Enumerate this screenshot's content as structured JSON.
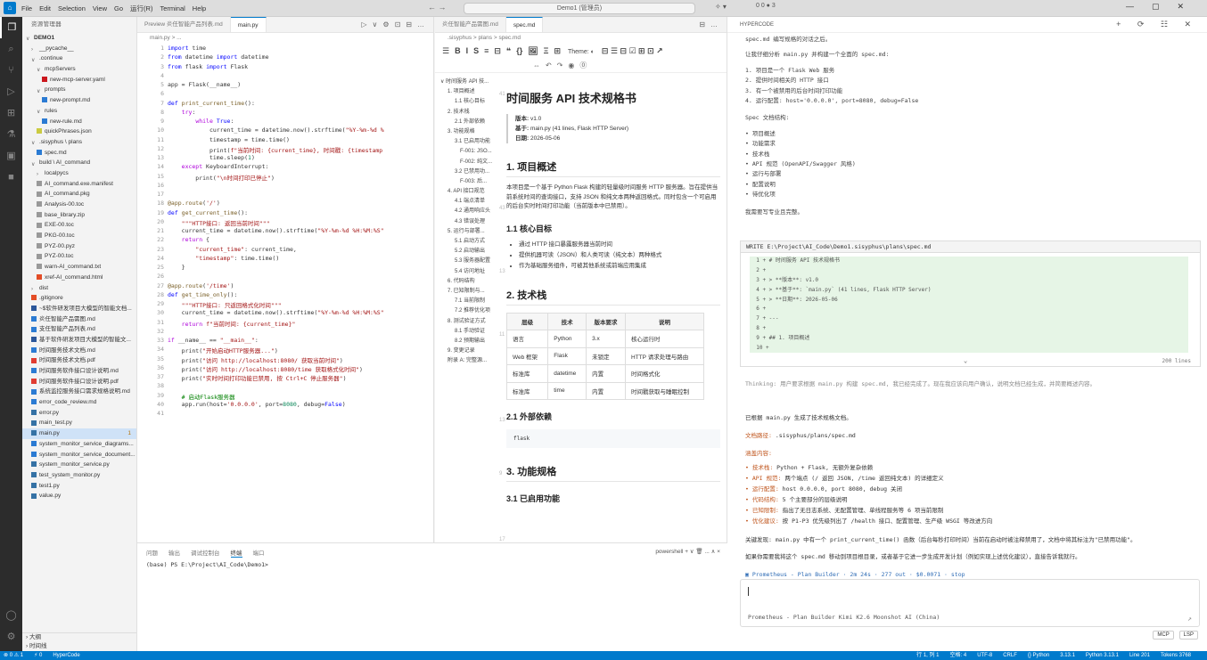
{
  "titlebar": {
    "menu": [
      "File",
      "Edit",
      "Selection",
      "View",
      "Go",
      "运行(R)",
      "Terminal",
      "Help"
    ],
    "search": "Demo1 (管理员)",
    "nav": "←  →",
    "badge": "0 0 ● 3",
    "controls": "▯ ▯ ▯ ▯"
  },
  "explorer": {
    "header": "资源管理器",
    "items": [
      {
        "t": "DEMO1",
        "d": 0,
        "k": "root"
      },
      {
        "t": "__pycache__",
        "d": 1,
        "k": "dir"
      },
      {
        "t": ".continue",
        "d": 1,
        "k": "diro"
      },
      {
        "t": "mcpServers",
        "d": 2,
        "k": "diro"
      },
      {
        "t": "new-mcp-server.yaml",
        "d": 3,
        "k": "yaml"
      },
      {
        "t": "prompts",
        "d": 2,
        "k": "diro"
      },
      {
        "t": "new-prompt.md",
        "d": 3,
        "k": "md"
      },
      {
        "t": "rules",
        "d": 2,
        "k": "diro"
      },
      {
        "t": "new-rule.md",
        "d": 3,
        "k": "md"
      },
      {
        "t": "quickPhrases.json",
        "d": 2,
        "k": "json"
      },
      {
        "t": ".sisyphus \\ plans",
        "d": 1,
        "k": "diro"
      },
      {
        "t": "spec.md",
        "d": 2,
        "k": "md"
      },
      {
        "t": "build \\ AI_command",
        "d": 1,
        "k": "diro"
      },
      {
        "t": "localpycs",
        "d": 2,
        "k": "dir"
      },
      {
        "t": "AI_command.exe.manifest",
        "d": 2,
        "k": "file"
      },
      {
        "t": "AI_command.pkg",
        "d": 2,
        "k": "file"
      },
      {
        "t": "Analysis-00.toc",
        "d": 2,
        "k": "file"
      },
      {
        "t": "base_library.zip",
        "d": 2,
        "k": "zip"
      },
      {
        "t": "EXE-00.toc",
        "d": 2,
        "k": "file"
      },
      {
        "t": "PKG-00.toc",
        "d": 2,
        "k": "file"
      },
      {
        "t": "PYZ-00.pyz",
        "d": 2,
        "k": "file"
      },
      {
        "t": "PYZ-00.toc",
        "d": 2,
        "k": "file"
      },
      {
        "t": "warn-AI_command.txt",
        "d": 2,
        "k": "file"
      },
      {
        "t": "xref-AI_command.html",
        "d": 2,
        "k": "html"
      },
      {
        "t": "dist",
        "d": 1,
        "k": "dir"
      },
      {
        "t": ".gitignore",
        "d": 1,
        "k": "git"
      },
      {
        "t": "~$软件研发项目大模型的智能文档...",
        "d": 1,
        "k": "doc"
      },
      {
        "t": "炎任智能产品需图.md",
        "d": 1,
        "k": "md"
      },
      {
        "t": "支任智能产品列表.md",
        "d": 1,
        "k": "md"
      },
      {
        "t": "基于软件研发项目大模型的智能文...",
        "d": 1,
        "k": "doc"
      },
      {
        "t": "时间服务技术文档.md",
        "d": 1,
        "k": "md"
      },
      {
        "t": "时间服务技术文档.pdf",
        "d": 1,
        "k": "pdf"
      },
      {
        "t": "时间服务软件接口设计说明.md",
        "d": 1,
        "k": "md"
      },
      {
        "t": "时间服务软件接口设计说明.pdf",
        "d": 1,
        "k": "pdf"
      },
      {
        "t": "系统监控服务接口需求规格说明.md",
        "d": 1,
        "k": "md"
      },
      {
        "t": "error_code_review.md",
        "d": 1,
        "k": "md"
      },
      {
        "t": "error.py",
        "d": 1,
        "k": "py"
      },
      {
        "t": "main_test.py",
        "d": 1,
        "k": "py"
      },
      {
        "t": "main.py",
        "d": 1,
        "k": "py",
        "sel": true,
        "badge": "1"
      },
      {
        "t": "system_monitor_service_diagrams...",
        "d": 1,
        "k": "md"
      },
      {
        "t": "system_monitor_service_document...",
        "d": 1,
        "k": "md"
      },
      {
        "t": "system_monitor_service.py",
        "d": 1,
        "k": "py"
      },
      {
        "t": "test_system_monitor.py",
        "d": 1,
        "k": "py"
      },
      {
        "t": "test1.py",
        "d": 1,
        "k": "py"
      },
      {
        "t": "value.py",
        "d": 1,
        "k": "py"
      }
    ],
    "footer": [
      "大纲",
      "时间线"
    ]
  },
  "editor1": {
    "tabs": [
      "Preview 炎任智能产品列表.md",
      "main.py"
    ],
    "crumb": "main.py > ...",
    "lines": [
      "<span class='kw'>import</span> time",
      "<span class='kw'>from</span> datetime <span class='kw'>import</span> datetime",
      "<span class='kw'>from</span> flask <span class='kw'>import</span> Flask",
      "",
      "app = Flask(__name__)",
      "",
      "<span class='kw'>def</span> <span class='fn'>print_current_time</span>():",
      "    <span class='de'>try</span>:",
      "        <span class='de'>while</span> <span class='kw'>True</span>:",
      "            current_time = datetime.now().strftime(<span class='st'>\"%Y-%m-%d %</span>",
      "            timestamp = time.time()",
      "            print(<span class='st'>f\"当前时间: {current_time}, 时间戳: {timestamp</span>",
      "            time.sleep(<span class='nm'>1</span>)",
      "    <span class='de'>except</span> KeyboardInterrupt:",
      "        print(<span class='st'>\"\\n时间打印已停止\"</span>)",
      "",
      "",
      "<span class='fn'>@app.route</span>(<span class='st'>'/'</span>)",
      "<span class='kw'>def</span> <span class='fn'>get_current_time</span>():",
      "    <span class='st'>\"\"\"HTTP接口: 返回当前时间\"\"\"</span>",
      "    current_time = datetime.now().strftime(<span class='st'>\"%Y-%m-%d %H:%M:%S\"</span>",
      "    <span class='de'>return</span> {",
      "        <span class='st'>\"current_time\"</span>: current_time,",
      "        <span class='st'>\"timestamp\"</span>: time.time()",
      "    }",
      "",
      "<span class='fn'>@app.route</span>(<span class='st'>'/time'</span>)",
      "<span class='kw'>def</span> <span class='fn'>get_time_only</span>():",
      "    <span class='st'>\"\"\"HTTP接口: 只返回格式化时间\"\"\"</span>",
      "    current_time = datetime.now().strftime(<span class='st'>\"%Y-%m-%d %H:%M:%S\"</span>",
      "    <span class='de'>return</span> <span class='st'>f\"当前时间: {current_time}\"</span>",
      "",
      "<span class='de'>if</span> __name__ == <span class='st'>\"__main__\"</span>:",
      "    print(<span class='st'>\"开始启动HTTP服务器...\"</span>)",
      "    print(<span class='st'>\"访问 http://localhost:8080/ 获取当前时间\"</span>)",
      "    print(<span class='st'>\"访问 http://localhost:8080/time 获取格式化时间\"</span>)",
      "    print(<span class='st'>\"实时时间打印功能已禁用, 按 Ctrl+C 停止服务器\"</span>)",
      "",
      "    <span class='cm'># 启动Flask服务器</span>",
      "    app.run(host=<span class='st'>'0.0.0.0'</span>, port=<span class='nm'>8080</span>, debug=<span class='kw'>False</span>)",
      ""
    ]
  },
  "panel": {
    "tabs": [
      "问题",
      "输出",
      "调试控制台",
      "终端",
      "端口"
    ],
    "active": "终端",
    "right": "powershell + ∨ 🗑 ... ∧ ×",
    "prompt": "(base) PS E:\\Project\\AI_Code\\Demo1>"
  },
  "editor2": {
    "tabs": [
      "炎任智能产品需图.md",
      "spec.md"
    ],
    "crumb": ".sisyphus > plans > spec.md",
    "toolbar": [
      "☰",
      "B",
      "I",
      "S",
      "≡",
      "⊟",
      "❝",
      "{}",
      "🖼",
      "Ξ",
      "⊞"
    ],
    "theme": "Theme: ◐",
    "toc": [
      "时间服务 API 技...",
      "1. 项目概述",
      "1.1 核心目标",
      "2. 技术栈",
      "2.1 外部依赖",
      "3. 功能规格",
      "3.1 已启用功能",
      "F-001: JSO...",
      "F-002: 纯文...",
      "3.2 已禁用功...",
      "F-003: 后...",
      "4. API 接口规范",
      "4.1 端点清单",
      "4.2 通用响应头",
      "4.3 错误处理",
      "5. 运行与部署...",
      "5.1 启动方式",
      "5.2 启动输出",
      "5.3 服务器配置",
      "5.4 访问地址",
      "6. 代码结构",
      "7. 已知限制与...",
      "7.1 当前限制",
      "7.2 推荐优化项",
      "8. 测试验证方式",
      "8.1 手动验证",
      "8.2 预期输出",
      "9. 变更记录",
      "附录 A: 完整源..."
    ],
    "doc": {
      "title": "时间服务 API 技术规格书",
      "meta": [
        [
          "版本",
          "v1.0"
        ],
        [
          "基于",
          "main.py (41 lines, Flask HTTP Server)"
        ],
        [
          "日期",
          "2026-05-06"
        ]
      ],
      "h_overview": "1. 项目概述",
      "overview": "本项目是一个基于 Python Flask 构建的轻量级时间服务 HTTP 服务器。旨在提供当前系统时间的查询接口，支持 JSON 和纯文本两种返回格式。同时包含一个可启用的后台实时时间打印功能（当前版本中已禁用）。",
      "h_goal": "1.1 核心目标",
      "goals": [
        "通过 HTTP 接口暴露服务器当前时间",
        "提供机器可读（JSON）和人类可读（纯文本）两种格式",
        "作为基础服务组件，可被其他系统或前端应用集成"
      ],
      "h_stack": "2. 技术栈",
      "table_head": [
        "层级",
        "技术",
        "版本要求",
        "说明"
      ],
      "table": [
        [
          "语言",
          "Python",
          "3.x",
          "核心运行时"
        ],
        [
          "Web 框架",
          "Flask",
          "未锁定",
          "HTTP 请求处理与路由"
        ],
        [
          "标准库",
          "datetime",
          "内置",
          "时间格式化"
        ],
        [
          "标准库",
          "time",
          "内置",
          "时间戳获取与睡眠控制"
        ]
      ],
      "h_dep": "2.1 外部依赖",
      "dep": "flask",
      "h_func": "3. 功能规格",
      "h_func1": "3.1 已启用功能",
      "gutter": [
        "41",
        "43",
        "13",
        "11",
        "13",
        "9",
        "17",
        "21",
        "48"
      ]
    }
  },
  "chat": {
    "header": "HYPERCODE",
    "icons": "+ ⟳ ☷ ✕",
    "l1": "spec.md 编写规格的对话之后。",
    "l2": "让我仔细分析 main.py 并构建一个全面的 spec.md:",
    "facts": [
      "1. 项目是一个 Flask Web 服务",
      "2. 提供时间相关的 HTTP 接口",
      "3. 有一个被禁用的后台时间打印功能",
      "4. 运行配置: host='0.0.0.0', port=8080, debug=False"
    ],
    "struct_title": "Spec 文档结构:",
    "struct": [
      "项目概述",
      "功能需求",
      "技术栈",
      "API 规范 (OpenAPI/Swagger 风格)",
      "运行与部署",
      "配置说明",
      "待优化项"
    ],
    "l3": "我需要写专业且完整。",
    "diff_title": "WRITE E:\\Project\\AI_Code\\Demo1.sisyphus\\plans\\spec.md",
    "diff": [
      "1 + # 时间服务 API 技术规格书",
      "2 +",
      "3 + > **版本**: v1.0",
      "4 + > **基于**: `main.py` (41 lines, Flask HTTP Server)",
      "5 + > **日期**: 2026-05-06",
      "6 +",
      "7 + ---",
      "8 +",
      "9 + ## 1. 项目概述",
      "10 +"
    ],
    "diff_footer": "200 lines",
    "thinking": "Thinking: 用户要求根据 main.py 构建 spec.md, 我已经完成了。现在我应该向用户确认，说明文档已经生成，并简要概述内容。",
    "done": "已根据 main.py 生成了技术规格文档。",
    "path_label": "文档路径:",
    "path": ".sisyphus/plans/spec.md",
    "cover_label": "涵盖内容:",
    "cover": [
      [
        "技术栈:",
        "Python + Flask, 无额外复杂依赖"
      ],
      [
        "API 规范:",
        "两个端点 (/ 返回 JSON, /time 返回纯文本) 的详细定义"
      ],
      [
        "运行配置:",
        "host 0.0.0.0, port 8080, debug 关闭"
      ],
      [
        "代码结构:",
        "5 个主要部分的层级说明"
      ],
      [
        "已知限制:",
        "指出了无日志系统、无配置管理、单线程服务等 6 项当前限制"
      ],
      [
        "优化建议:",
        "按 P1-P3 优先级列出了 /health 接口、配置管理、生产级 WSGI 等改进方向"
      ]
    ],
    "key": "关键发现: main.py 中有一个 print_current_time() 函数（后台每秒打印时间）当前在启动时被注释禁用了，文档中将其标注为\"已禁用功能\"。",
    "next": "如果你需要我将这个 spec.md 移动到项目根目录，或者基于它进一步生成开发计划（例如实现上述优化建议），直接告诉我就行。",
    "runline": "▣ Prometheus - Plan Builder · 2m 24s · 277 out · $0.0071 · stop",
    "model": "Prometheus - Plan Builder  Kimi K2.6 Moonshot AI (China)",
    "buttons": [
      "MCP",
      "LSP"
    ]
  },
  "statusbar": {
    "left": [
      "⊗ 0 ⚠ 1",
      "⚡ 0",
      "HyperCode"
    ],
    "right": [
      "行 1, 列 1",
      "空格: 4",
      "UTF-8",
      "CRLF",
      "{} Python",
      "3.13.1",
      "Python 3.13.1",
      "Line 201",
      "Tokens 3768"
    ]
  },
  "colors": {
    "accent": "#007acc",
    "status": "#007acc",
    "activity": "#2c2c2c"
  }
}
